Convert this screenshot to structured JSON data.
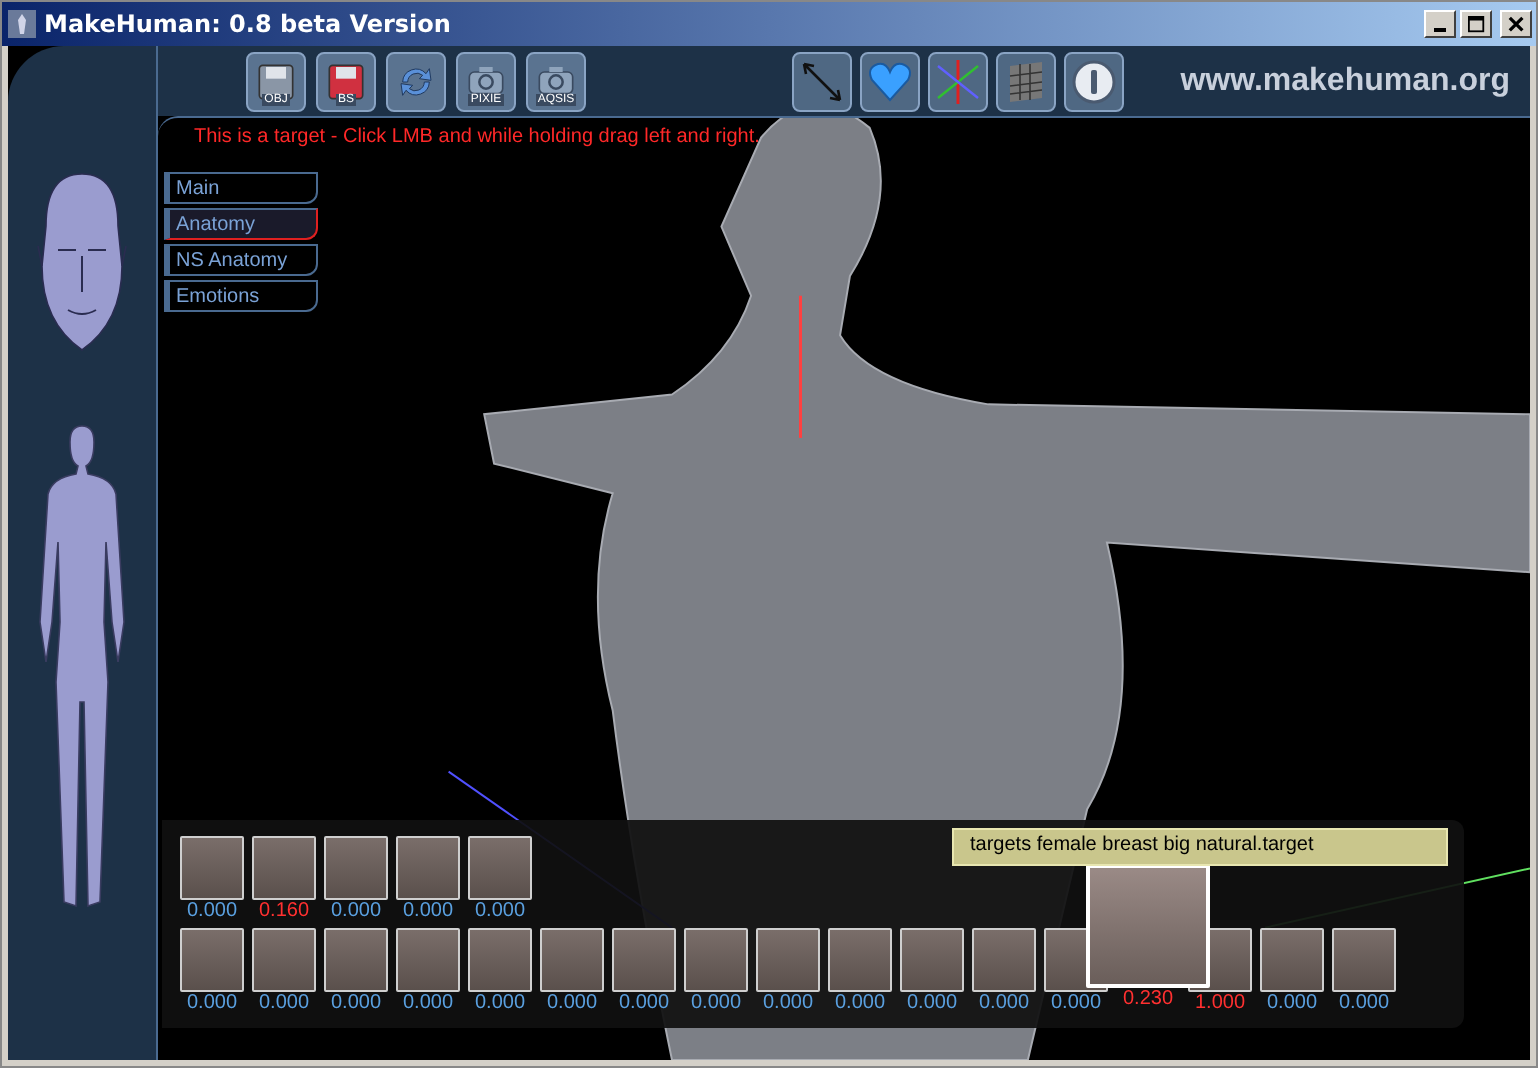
{
  "window": {
    "title": "MakeHuman: 0.8 beta Version"
  },
  "toolbar": {
    "file_buttons": [
      {
        "kind": "export",
        "label": "OBJ"
      },
      {
        "kind": "save",
        "label": "BS"
      },
      {
        "kind": "reset"
      },
      {
        "kind": "render",
        "label": "PIXIE"
      },
      {
        "kind": "render",
        "label": "AQSIS"
      }
    ],
    "view_buttons": [
      {
        "kind": "measure"
      },
      {
        "kind": "heart"
      },
      {
        "kind": "axes"
      },
      {
        "kind": "grid"
      },
      {
        "kind": "info"
      }
    ],
    "site": "www.makehuman.org"
  },
  "hint": "This is a target - Click LMB and while holding drag left and right.",
  "tabs": [
    {
      "label": "Main",
      "selected": false
    },
    {
      "label": "Anatomy",
      "selected": true
    },
    {
      "label": "NS Anatomy",
      "selected": false
    },
    {
      "label": "Emotions",
      "selected": false
    }
  ],
  "tooltip": "targets female breast big natural.target",
  "target_rows": [
    [
      {
        "value": "0.000",
        "modified": false,
        "selected": false
      },
      {
        "value": "0.160",
        "modified": true,
        "selected": false
      },
      {
        "value": "0.000",
        "modified": false,
        "selected": false
      },
      {
        "value": "0.000",
        "modified": false,
        "selected": false
      },
      {
        "value": "0.000",
        "modified": false,
        "selected": false
      }
    ],
    [
      {
        "value": "0.000",
        "modified": false,
        "selected": false
      },
      {
        "value": "0.000",
        "modified": false,
        "selected": false
      },
      {
        "value": "0.000",
        "modified": false,
        "selected": false
      },
      {
        "value": "0.000",
        "modified": false,
        "selected": false
      },
      {
        "value": "0.000",
        "modified": false,
        "selected": false
      },
      {
        "value": "0.000",
        "modified": false,
        "selected": false
      },
      {
        "value": "0.000",
        "modified": false,
        "selected": false
      },
      {
        "value": "0.000",
        "modified": false,
        "selected": false
      },
      {
        "value": "0.000",
        "modified": false,
        "selected": false
      },
      {
        "value": "0.000",
        "modified": false,
        "selected": false
      },
      {
        "value": "0.000",
        "modified": false,
        "selected": false
      },
      {
        "value": "0.000",
        "modified": false,
        "selected": false
      },
      {
        "value": "0.000",
        "modified": false,
        "selected": false
      },
      {
        "value": "0.230",
        "modified": true,
        "selected": true
      },
      {
        "value": "1.000",
        "modified": true,
        "selected": false
      },
      {
        "value": "0.000",
        "modified": false,
        "selected": false
      },
      {
        "value": "0.000",
        "modified": false,
        "selected": false
      }
    ]
  ]
}
